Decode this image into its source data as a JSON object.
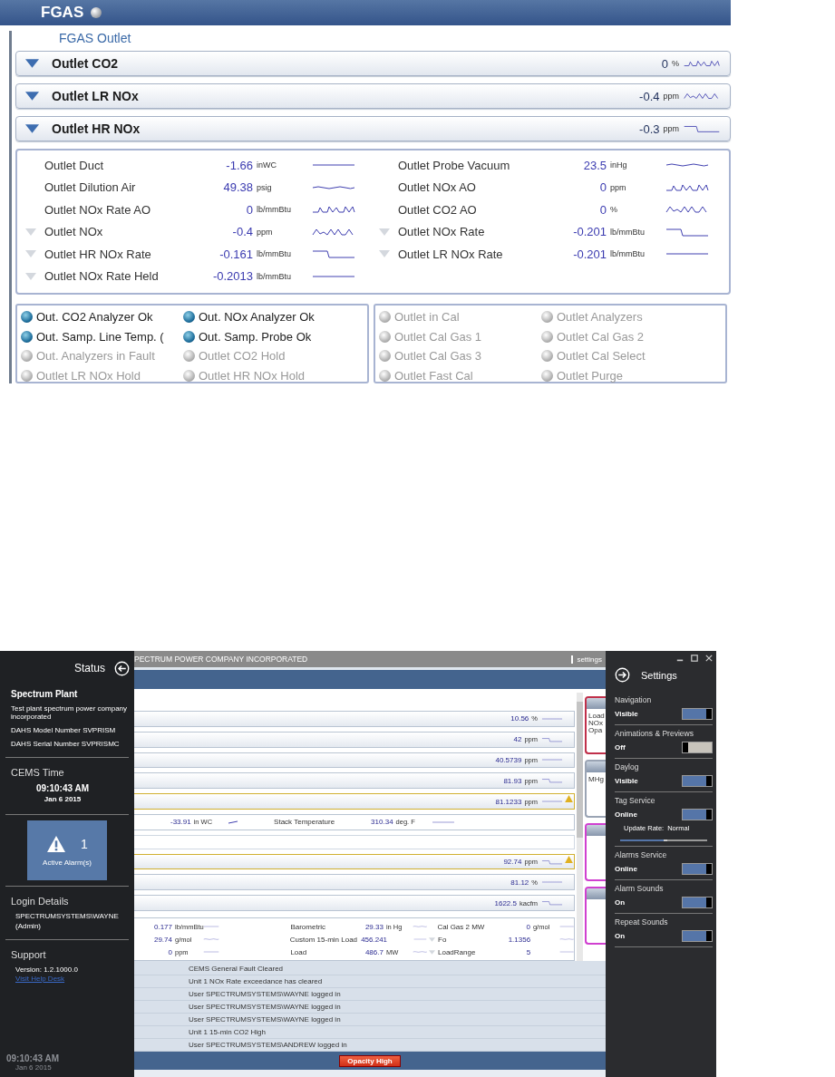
{
  "fgas": {
    "title": "FGAS",
    "section_title": "FGAS Outlet",
    "groups": [
      {
        "name": "Outlet CO2",
        "value": "0",
        "unit": "%"
      },
      {
        "name": "Outlet LR NOx",
        "value": "-0.4",
        "unit": "ppm"
      },
      {
        "name": "Outlet HR NOx",
        "value": "-0.3",
        "unit": "ppm"
      }
    ],
    "readings_left": [
      {
        "label": "Outlet Duct",
        "value": "-1.66",
        "unit": "inWC",
        "expandable": false
      },
      {
        "label": "Outlet Dilution Air",
        "value": "49.38",
        "unit": "psig",
        "expandable": false
      },
      {
        "label": "Outlet NOx Rate AO",
        "value": "0",
        "unit": "lb/mmBtu",
        "expandable": false
      },
      {
        "label": "Outlet NOx",
        "value": "-0.4",
        "unit": "ppm",
        "expandable": true
      },
      {
        "label": "Outlet HR NOx Rate",
        "value": "-0.161",
        "unit": "lb/mmBtu",
        "expandable": true
      },
      {
        "label": "Outlet NOx Rate Held",
        "value": "-0.2013",
        "unit": "lb/mmBtu",
        "expandable": true
      }
    ],
    "readings_right": [
      {
        "label": "Outlet Probe Vacuum",
        "value": "23.5",
        "unit": "inHg",
        "expandable": false
      },
      {
        "label": "Outlet NOx AO",
        "value": "0",
        "unit": "ppm",
        "expandable": false
      },
      {
        "label": "Outlet CO2 AO",
        "value": "0",
        "unit": "%",
        "expandable": false
      },
      {
        "label": "Outlet NOx Rate",
        "value": "-0.201",
        "unit": "lb/mmBtu",
        "expandable": true
      },
      {
        "label": "Outlet LR NOx Rate",
        "value": "-0.201",
        "unit": "lb/mmBtu",
        "expandable": true
      }
    ],
    "indicators_left": [
      {
        "label": "Out. CO2 Analyzer Ok",
        "on": true
      },
      {
        "label": "Out. NOx Analyzer Ok",
        "on": true
      },
      {
        "label": "Out. Samp. Line Temp. (",
        "on": true
      },
      {
        "label": "Out. Samp. Probe Ok",
        "on": true
      },
      {
        "label": "Out. Analyzers in Fault",
        "on": false
      },
      {
        "label": "Outlet CO2 Hold",
        "on": false
      },
      {
        "label": "Outlet LR NOx Hold",
        "on": false
      },
      {
        "label": "Outlet HR NOx Hold",
        "on": false
      }
    ],
    "indicators_right": [
      {
        "label": "Outlet in Cal",
        "on": false
      },
      {
        "label": "Outlet Analyzers",
        "on": false
      },
      {
        "label": "Outlet Cal Gas 1",
        "on": false
      },
      {
        "label": "Outlet Cal Gas 2",
        "on": false
      },
      {
        "label": "Outlet Cal Gas 3",
        "on": false
      },
      {
        "label": "Outlet Cal Select",
        "on": false
      },
      {
        "label": "Outlet Fast Cal",
        "on": false
      },
      {
        "label": "Outlet Purge",
        "on": false
      }
    ]
  },
  "app": {
    "title": "PECTRUM POWER COMPANY INCORPORATED",
    "settings_link": "settings",
    "status": {
      "heading": "Status",
      "plant": "Spectrum Plant",
      "description": "Test plant spectrum power company incorporated",
      "model": "DAHS Model Number SVPRISM",
      "serial": "DAHS Serial Number SVPRISMC",
      "time_heading": "CEMS Time",
      "time": "09:10:43 AM",
      "date": "Jan 6 2015",
      "alarm_count": "1",
      "alarm_label": "Active Alarm(s)",
      "login_heading": "Login Details",
      "user": "SPECTRUMSYSTEMS\\WAYNE",
      "role": "(Admin)",
      "support_heading": "Support",
      "version": "Version: 1.2.1000.0",
      "help_link": "Visit Help Desk",
      "footer_time": "09:10:43 AM",
      "footer_date": "Jan 6 2015"
    },
    "rows": [
      {
        "kind": "bar",
        "value": "10.56",
        "unit": "%",
        "alarm": false
      },
      {
        "kind": "bar",
        "value": "42",
        "unit": "ppm",
        "alarm": false
      },
      {
        "kind": "bar",
        "value": "40.5739",
        "unit": "ppm",
        "alarm": false
      },
      {
        "kind": "bar",
        "value": "81.93",
        "unit": "ppm",
        "alarm": false
      },
      {
        "kind": "bar",
        "value": "81.1233",
        "unit": "ppm",
        "alarm": true
      },
      {
        "kind": "detail",
        "value": "-33.91",
        "unit": "in WC",
        "label2": "Stack Temperature",
        "value2": "310.34",
        "unit2": "deg. F"
      },
      {
        "kind": "blank"
      },
      {
        "kind": "bar",
        "value": "92.74",
        "unit": "ppm",
        "alarm": true
      },
      {
        "kind": "bar",
        "value": "81.12",
        "unit": "%",
        "alarm": false
      },
      {
        "kind": "bar",
        "value": "1622.5",
        "unit": "kacfm",
        "alarm": false
      }
    ],
    "grid": [
      [
        {
          "value": "0.177",
          "unit": "lb/mmBtu",
          "expandable": false
        },
        {
          "label": "Barometric",
          "value": "29.33",
          "unit": "in Hg",
          "expandable": false
        },
        {
          "label": "Cal Gas 2 MW",
          "value": "0",
          "unit": "g/mol",
          "expandable": false
        }
      ],
      [
        {
          "value": "29.74",
          "unit": "g/mol",
          "expandable": false
        },
        {
          "label": "Custom 15-min Load",
          "value": "456.241",
          "expandable": false
        },
        {
          "label": "Fo",
          "value": "1.1356",
          "expandable": true
        }
      ],
      [
        {
          "value": "0",
          "unit": "ppm",
          "expandable": false
        },
        {
          "label": "Load",
          "value": "486.7",
          "unit": "MW",
          "expandable": false
        },
        {
          "label": "LoadRange",
          "value": "5",
          "expandable": true
        }
      ]
    ],
    "log": [
      "CEMS General Fault Cleared",
      "Unit 1 NOx Rate exceedance has cleared",
      "User SPECTRUMSYSTEMS\\WAYNE logged in",
      "User SPECTRUMSYSTEMS\\WAYNE logged in",
      "User SPECTRUMSYSTEMS\\WAYNE logged in",
      "Unit 1 15-min CO2 High",
      "User SPECTRUMSYSTEMS\\ANDREW logged in"
    ],
    "side_cards": [
      {
        "kind": "alarm",
        "lines": [
          "Load",
          "NOx",
          "Opa"
        ]
      },
      {
        "kind": "normal",
        "lines": [
          "MHg"
        ]
      },
      {
        "kind": "maintenance"
      },
      {
        "kind": "maintenance"
      }
    ],
    "alarm_button": "Opacity High",
    "settings": {
      "heading": "Settings",
      "items": [
        {
          "title": "Navigation",
          "state": "Visible",
          "on": true
        },
        {
          "title": "Animations & Previews",
          "state": "Off",
          "on": false
        },
        {
          "title": "Daylog",
          "state": "Visible",
          "on": true
        },
        {
          "title": "Tag Service",
          "state": "Online",
          "on": true,
          "rate_label": "Update Rate:",
          "rate": "Normal",
          "level": 0.5
        },
        {
          "title": "Alarms Service",
          "state": "Online",
          "on": true
        },
        {
          "title": "Alarm Sounds",
          "state": "On",
          "on": true
        },
        {
          "title": "Repeat Sounds",
          "state": "On",
          "on": true
        }
      ]
    }
  }
}
